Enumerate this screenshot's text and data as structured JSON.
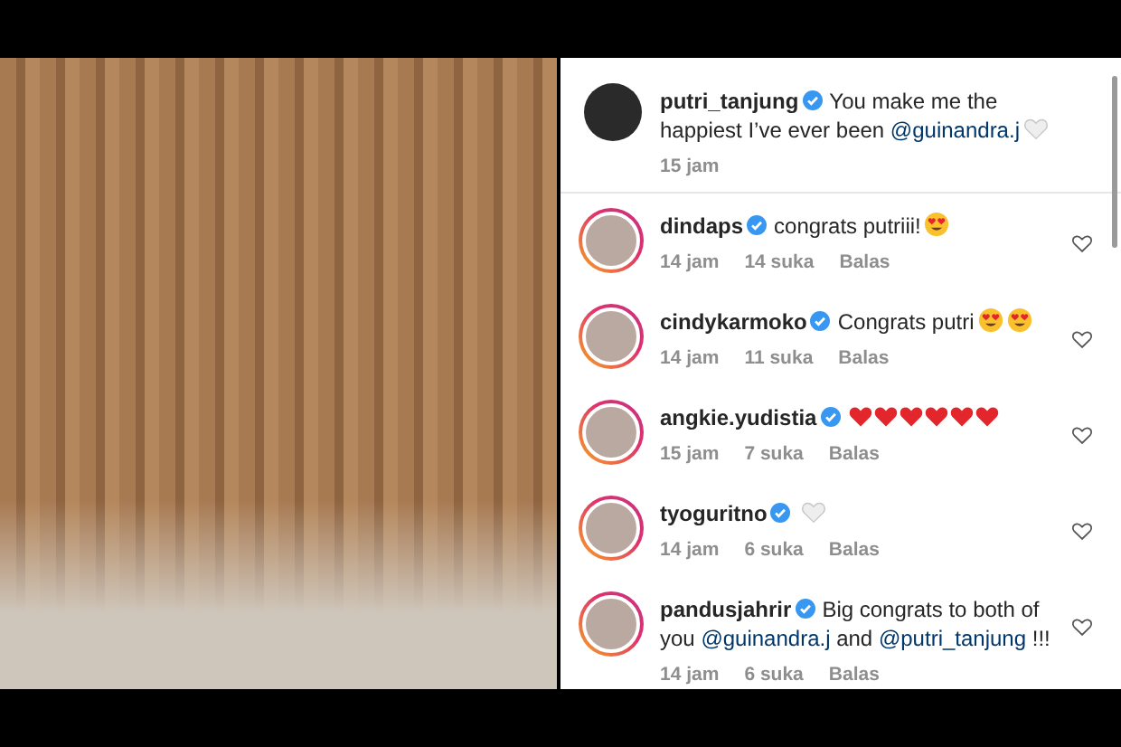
{
  "post": {
    "caption": {
      "username": "putri_tanjung",
      "verified": true,
      "parts": [
        {
          "kind": "text",
          "text": "You make me the happiest I’ve ever been "
        },
        {
          "kind": "mention",
          "text": "@guinandra.j"
        }
      ],
      "emojis": [
        {
          "kind": "white_heart"
        }
      ],
      "time": "15 jam"
    },
    "comments": [
      {
        "username": "dindaps",
        "verified": true,
        "story_ring": true,
        "parts": [
          {
            "kind": "text",
            "text": "congrats putriii!"
          }
        ],
        "emojis": [
          {
            "kind": "heart_eyes"
          }
        ],
        "time": "14 jam",
        "likes": "14 suka",
        "reply": "Balas"
      },
      {
        "username": "cindykarmoko",
        "verified": true,
        "story_ring": true,
        "parts": [
          {
            "kind": "text",
            "text": "Congrats putri"
          }
        ],
        "emojis": [
          {
            "kind": "heart_eyes"
          },
          {
            "kind": "heart_eyes"
          }
        ],
        "time": "14 jam",
        "likes": "11 suka",
        "reply": "Balas"
      },
      {
        "username": "angkie.yudistia",
        "verified": true,
        "story_ring": true,
        "emojis": [
          {
            "kind": "red_heart"
          },
          {
            "kind": "red_heart"
          },
          {
            "kind": "red_heart"
          },
          {
            "kind": "red_heart"
          },
          {
            "kind": "red_heart"
          },
          {
            "kind": "red_heart"
          }
        ],
        "time": "15 jam",
        "likes": "7 suka",
        "reply": "Balas"
      },
      {
        "username": "tyoguritno",
        "verified": true,
        "story_ring": true,
        "emojis": [
          {
            "kind": "white_heart"
          }
        ],
        "time": "14 jam",
        "likes": "6 suka",
        "reply": "Balas"
      },
      {
        "username": "pandusjahrir",
        "verified": true,
        "story_ring": true,
        "parts": [
          {
            "kind": "text",
            "text": "Big congrats to both of you "
          },
          {
            "kind": "mention",
            "text": "@guinandra.j"
          },
          {
            "kind": "text",
            "text": " and "
          },
          {
            "kind": "mention",
            "text": "@putri_tanjung"
          },
          {
            "kind": "text",
            "text": " !!!"
          }
        ],
        "time": "14 jam",
        "likes": "6 suka",
        "reply": "Balas"
      }
    ]
  }
}
